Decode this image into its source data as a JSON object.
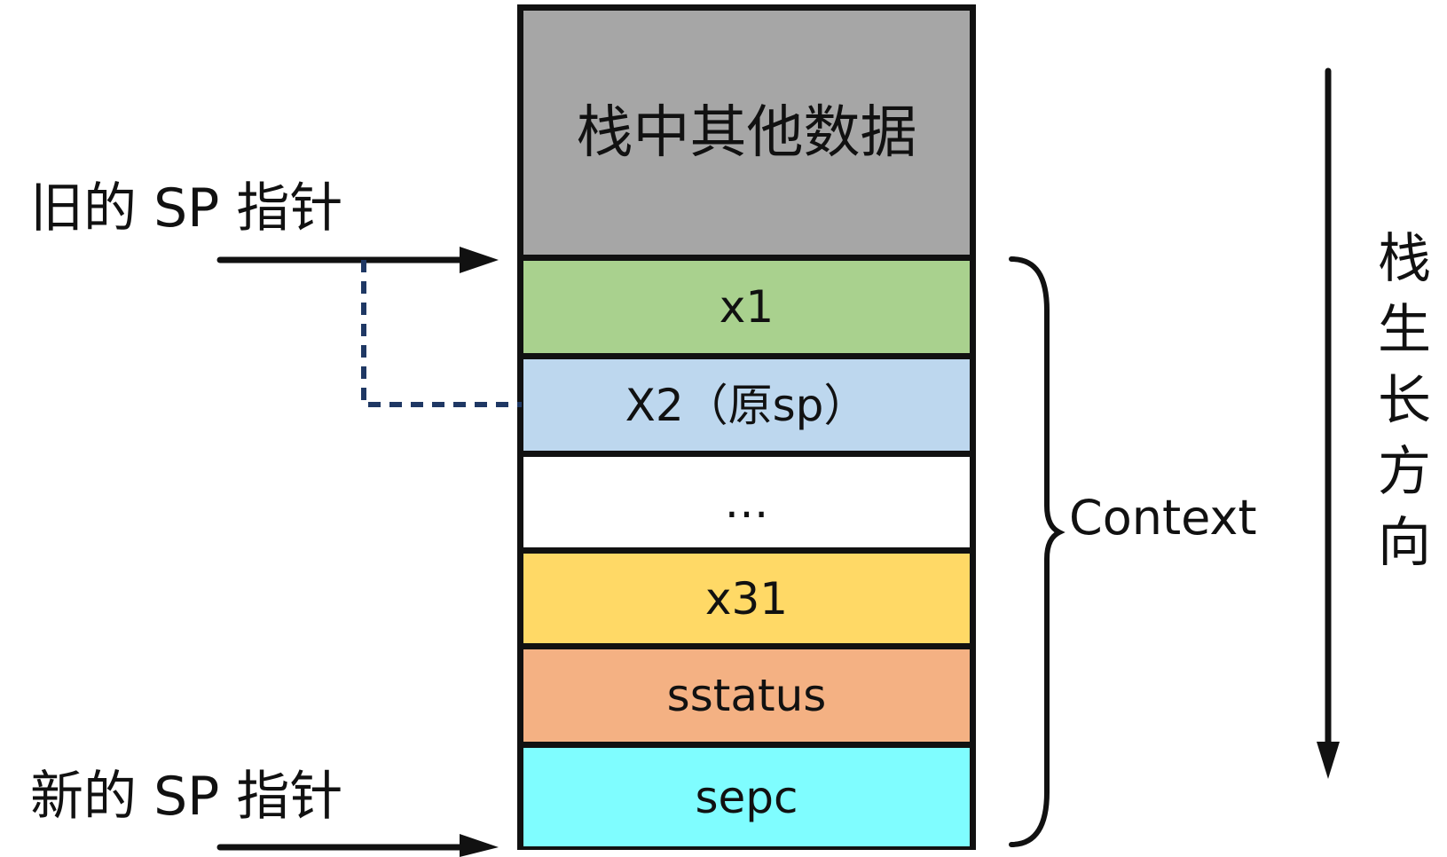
{
  "stack": {
    "blocks": [
      {
        "label": "栈中其他数据",
        "color": "#a6a6a6"
      },
      {
        "label": "x1",
        "color": "#a9d18e"
      },
      {
        "label": "X2（原sp）",
        "color": "#bdd7ee"
      },
      {
        "label": "…",
        "color": "#ffffff"
      },
      {
        "label": "x31",
        "color": "#ffd966"
      },
      {
        "label": "sstatus",
        "color": "#f4b183"
      },
      {
        "label": "sepc",
        "color": "#7ffdff"
      }
    ]
  },
  "old_sp_label": "旧的 SP 指针",
  "new_sp_label": "新的 SP 指针",
  "context_label": "Context",
  "growth_direction_chars": [
    "栈",
    "生",
    "长",
    "方",
    "向"
  ],
  "colors": {
    "outline": "#111111",
    "dotted_link": "#1f3864"
  }
}
